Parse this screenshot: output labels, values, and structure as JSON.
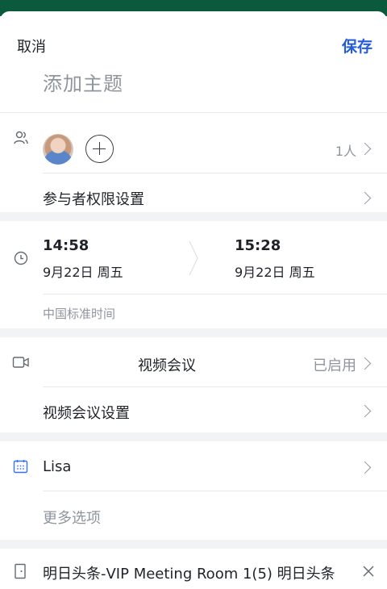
{
  "header": {
    "cancel_label": "取消",
    "save_label": "保存",
    "subject_placeholder": "添加主题"
  },
  "participants": {
    "count_label": "1人",
    "permission_label": "参与者权限设置"
  },
  "time": {
    "start_time": "14:58",
    "start_date": "9月22日 周五",
    "end_time": "15:28",
    "end_date": "9月22日 周五",
    "timezone": "中国标准时间"
  },
  "video": {
    "title": "视频会议",
    "status": "已启用",
    "settings_label": "视频会议设置"
  },
  "calendar": {
    "name": "Lisa",
    "more_options": "更多选项"
  },
  "room": {
    "name": "明日头条-VIP Meeting Room 1(5) 明日头条"
  },
  "colors": {
    "accent": "#245bdb",
    "topbar": "#0b5a3e",
    "muted": "#8f959e"
  }
}
